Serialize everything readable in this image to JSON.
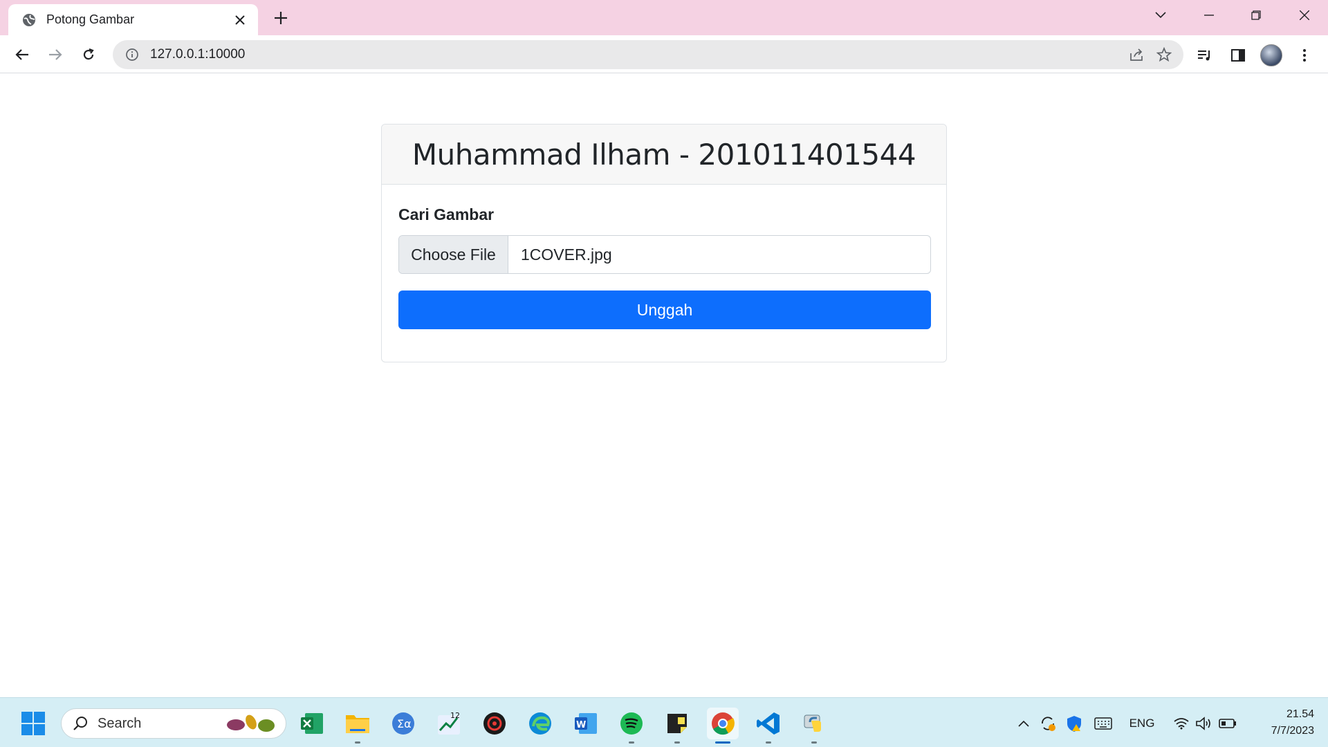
{
  "browser": {
    "tab_title": "Potong Gambar",
    "url": "127.0.0.1:10000"
  },
  "page": {
    "header_title": "Muhammad Ilham - 201011401544",
    "form_label": "Cari Gambar",
    "file_button_label": "Choose File",
    "file_name": "1COVER.jpg",
    "submit_label": "Unggah",
    "accent_color": "#0d6efd"
  },
  "taskbar": {
    "search_placeholder": "Search",
    "language": "ENG",
    "time": "21.54",
    "date": "7/7/2023",
    "apps": [
      "excel-icon",
      "file-explorer-icon",
      "math-app-icon",
      "stocks-app-icon",
      "security-app-icon",
      "edge-icon",
      "word-icon",
      "spotify-icon",
      "sticky-notes-icon",
      "chrome-icon",
      "vscode-icon",
      "python-icon"
    ]
  }
}
